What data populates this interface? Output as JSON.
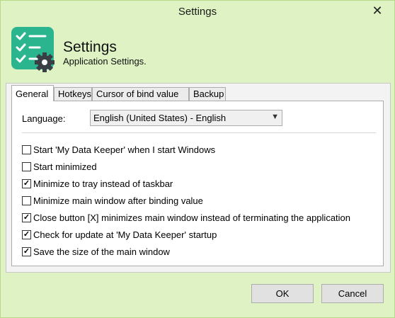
{
  "window": {
    "title": "Settings",
    "close_glyph": "✕"
  },
  "header": {
    "title": "Settings",
    "subtitle": "Application Settings.",
    "icon": "checklist-gear-icon"
  },
  "tabs": [
    {
      "label": "General",
      "active": true
    },
    {
      "label": "Hotkeys",
      "active": false
    },
    {
      "label": "Cursor of bind value",
      "active": false
    },
    {
      "label": "Backup",
      "active": false
    }
  ],
  "language": {
    "label": "Language:",
    "selected": "English (United States) - English"
  },
  "checkboxes": [
    {
      "label": "Start 'My Data Keeper' when I start Windows",
      "checked": false
    },
    {
      "label": "Start minimized",
      "checked": false
    },
    {
      "label": "Minimize to tray instead of taskbar",
      "checked": true
    },
    {
      "label": "Minimize main window after binding value",
      "checked": false
    },
    {
      "label": "Close button [X] minimizes main window instead of terminating the application",
      "checked": true
    },
    {
      "label": "Check for update at 'My Data Keeper' startup",
      "checked": true
    },
    {
      "label": "Save the size of the main window",
      "checked": true
    }
  ],
  "buttons": {
    "ok": "OK",
    "cancel": "Cancel"
  },
  "colors": {
    "accent": "#2bb58f",
    "window_bg": "#dff2c4"
  }
}
